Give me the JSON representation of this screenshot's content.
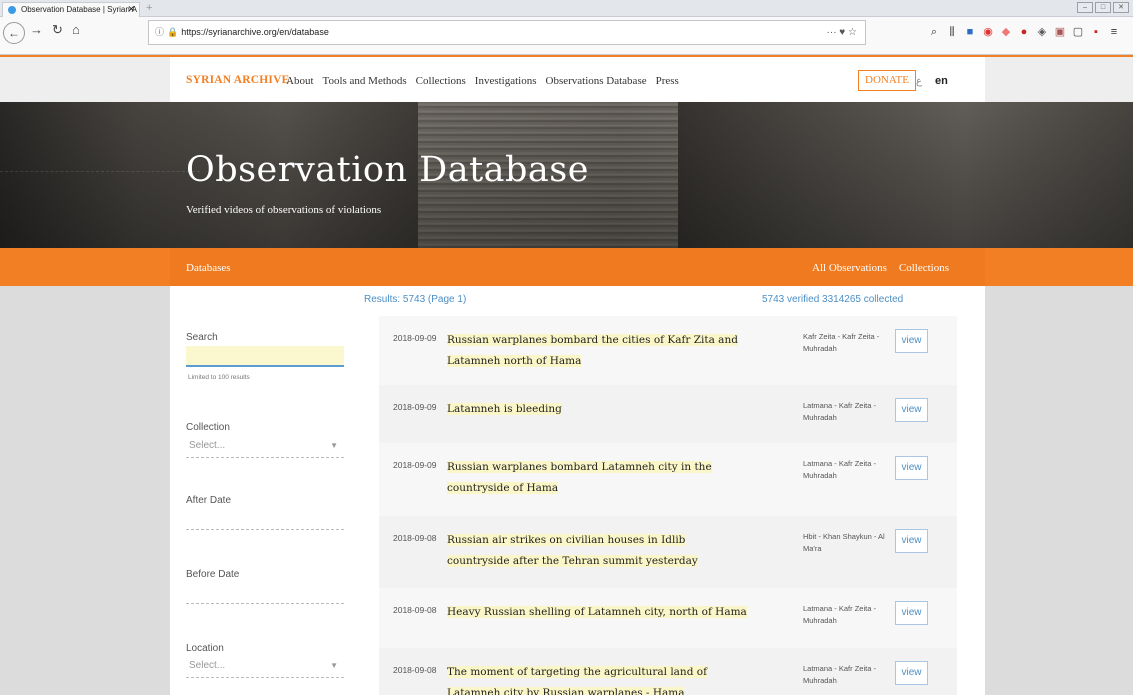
{
  "browser": {
    "tab_title": "Observation Database | Syrian A",
    "url": "https://syrianarchive.org/en/database",
    "url_right": "···",
    "colors": {
      "accent": "#f27f23",
      "link": "#4b8fc6"
    }
  },
  "site": {
    "brand": "SYRIAN ARCHIVE",
    "nav": [
      "About",
      "Tools and Methods",
      "Collections",
      "Investigations",
      "Observations Database",
      "Press"
    ],
    "donate": "DONATE",
    "lang": "en"
  },
  "hero": {
    "title": "Observation Database",
    "subtitle": "Verified videos of observations of violations"
  },
  "subbar": {
    "left": "Databases",
    "right": [
      "All Observations",
      "Collections"
    ]
  },
  "filters": {
    "search_label": "Search",
    "search_value": "",
    "limit_note": "Limited to 100 results",
    "collection_label": "Collection",
    "collection_value": "Select...",
    "after_label": "After Date",
    "before_label": "Before Date",
    "location_label": "Location",
    "location_value": "Select..."
  },
  "results": {
    "summary": "Results: 5743 (Page 1)",
    "verified": "5743 verified 3314265 collected",
    "view_label": "view",
    "items": [
      {
        "date": "2018-09-09",
        "title": "Russian warplanes bombard the cities of Kafr Zita and Latamneh north of Hama",
        "location": "Kafr Zeita - Kafr Zeita - Muhradah"
      },
      {
        "date": "2018-09-09",
        "title": "Latamneh is bleeding",
        "location": "Latmana - Kafr Zeita - Muhradah"
      },
      {
        "date": "2018-09-09",
        "title": "Russian warplanes bombard Latamneh city in the countryside of Hama",
        "location": "Latmana - Kafr Zeita - Muhradah"
      },
      {
        "date": "2018-09-08",
        "title": "Russian air strikes on civilian houses in Idlib countryside after the Tehran summit yesterday",
        "location": "Hbit - Khan Shaykun - Al Ma'ra"
      },
      {
        "date": "2018-09-08",
        "title": "Heavy Russian shelling of Latamneh city, north of Hama",
        "location": "Latmana - Kafr Zeita - Muhradah"
      },
      {
        "date": "2018-09-08",
        "title": "The moment of targeting the agricultural land of Latamneh city by Russian warplanes - Hama countryside",
        "location": "Latmana - Kafr Zeita - Muhradah"
      }
    ]
  }
}
